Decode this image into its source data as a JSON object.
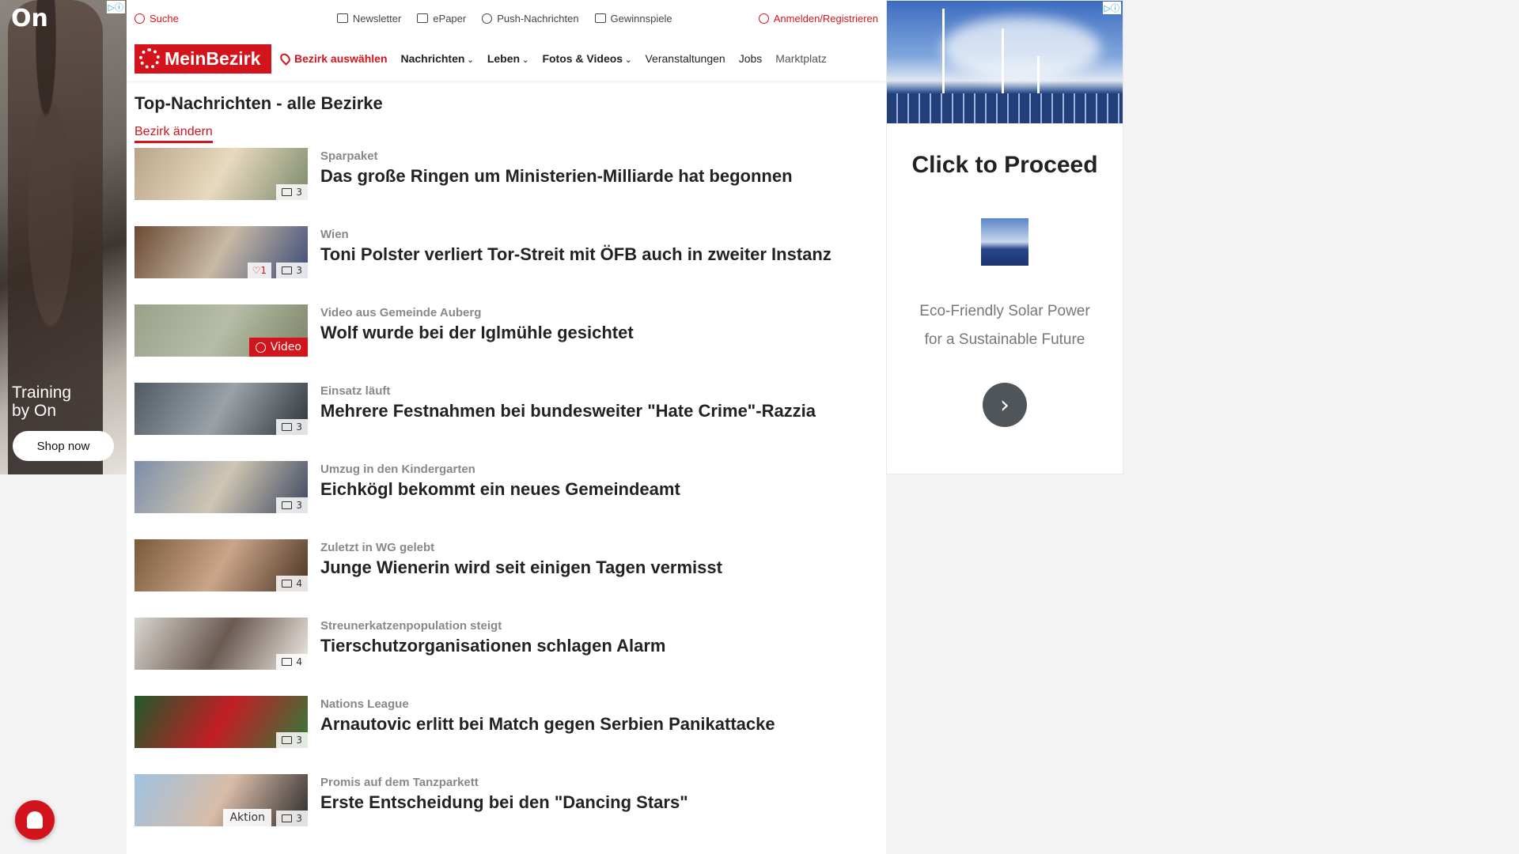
{
  "ad_left": {
    "badge": "▷ⓘ",
    "logo": "On",
    "slogan_line1": "Training",
    "slogan_line2": "by On",
    "button": "Shop now"
  },
  "utility": {
    "search": "Suche",
    "newsletter": "Newsletter",
    "epaper": "ePaper",
    "push": "Push-Nachrichten",
    "gewinnspiele": "Gewinnspiele",
    "login": "Anmelden/Registrieren"
  },
  "nav": {
    "brand": "MeinBezirk",
    "bezirk": "Bezirk auswählen",
    "nachrichten": "Nachrichten",
    "leben": "Leben",
    "fotos": "Fotos & Videos",
    "veranstaltungen": "Veranstaltungen",
    "jobs": "Jobs",
    "marktplatz": "Marktplatz"
  },
  "page": {
    "title": "Top-Nachrichten - alle Bezirke",
    "change": "Bezirk ändern"
  },
  "articles": [
    {
      "kicker": "Sparpaket",
      "headline": "Das große Ringen um Ministerien-Milliarde hat begonnen",
      "count": "3",
      "colors": [
        "#b9a48a",
        "#e8d9bf",
        "#7a8a6a"
      ]
    },
    {
      "kicker": "Wien",
      "headline": "Toni Polster verliert Tor-Streit mit ÖFB auch in zweiter Instanz",
      "count": "3",
      "likes": "♡1",
      "colors": [
        "#6b4a33",
        "#c8b9a5",
        "#3a4a78"
      ]
    },
    {
      "kicker": "Video aus Gemeinde Auberg",
      "headline": "Wolf wurde bei der Iglmühle gesichtet",
      "video": "Video",
      "colors": [
        "#9aa189",
        "#b7bca6",
        "#7c8468"
      ]
    },
    {
      "kicker": "Einsatz läuft",
      "headline": "Mehrere Festnahmen bei bundesweiter \"Hate Crime\"-Razzia",
      "count": "3",
      "colors": [
        "#505a63",
        "#9aa2a8",
        "#2e3439"
      ]
    },
    {
      "kicker": "Umzug in den Kindergarten",
      "headline": "Eichkögl bekommt ein neues Gemeindeamt",
      "count": "3",
      "colors": [
        "#7d8ea8",
        "#cfc6b2",
        "#3b4660"
      ]
    },
    {
      "kicker": "Zuletzt in WG gelebt",
      "headline": "Junge Wienerin wird seit einigen Tagen vermisst",
      "count": "4",
      "colors": [
        "#7a5a3a",
        "#caa58a",
        "#4a3322"
      ]
    },
    {
      "kicker": "Streunerkatzenpopulation steigt",
      "headline": "Tierschutzorganisationen schlagen Alarm",
      "count": "4",
      "colors": [
        "#d9d6d0",
        "#6a5a52",
        "#f0ece6"
      ]
    },
    {
      "kicker": "Nations League",
      "headline": "Arnautovic erlitt bei Match gegen Serbien Panikattacke",
      "count": "3",
      "colors": [
        "#1f5a2c",
        "#c21e24",
        "#2f7a3a"
      ]
    },
    {
      "kicker": "Promis auf dem Tanzparkett",
      "headline": "Erste Entscheidung bei den \"Dancing Stars\"",
      "count": "3",
      "aktion": "Aktion",
      "colors": [
        "#9fc2e0",
        "#d8bca8",
        "#2a2a2a"
      ]
    }
  ],
  "ad_right": {
    "badge": "▷ⓘ",
    "title": "Click to Proceed",
    "desc_line1": "Eco-Friendly Solar Power",
    "desc_line2": "for a Sustainable Future",
    "go_icon": "›"
  },
  "theme": {
    "accent": "#d4141c"
  }
}
